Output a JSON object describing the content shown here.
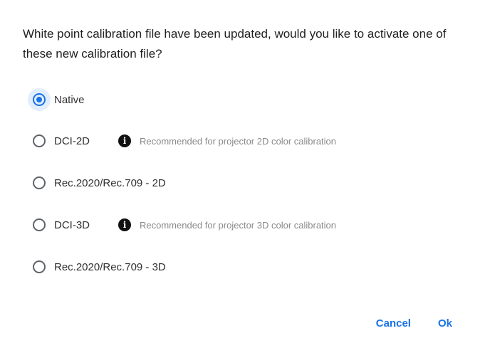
{
  "dialog": {
    "message": "White point calibration file have been updated, would you like to activate one of these new calibration file?",
    "options": [
      {
        "label": "Native",
        "checked": true,
        "info": ""
      },
      {
        "label": "DCI-2D",
        "checked": false,
        "info": "Recommended for projector 2D color calibration"
      },
      {
        "label": "Rec.2020/Rec.709 - 2D",
        "checked": false,
        "info": ""
      },
      {
        "label": "DCI-3D",
        "checked": false,
        "info": "Recommended for projector 3D color calibration"
      },
      {
        "label": "Rec.2020/Rec.709 - 3D",
        "checked": false,
        "info": ""
      }
    ],
    "info_icon_glyph": "i",
    "cancel_label": "Cancel",
    "ok_label": "Ok"
  },
  "colors": {
    "accent": "#1a73e8",
    "text": "#212121",
    "muted": "#8a8a8a"
  }
}
